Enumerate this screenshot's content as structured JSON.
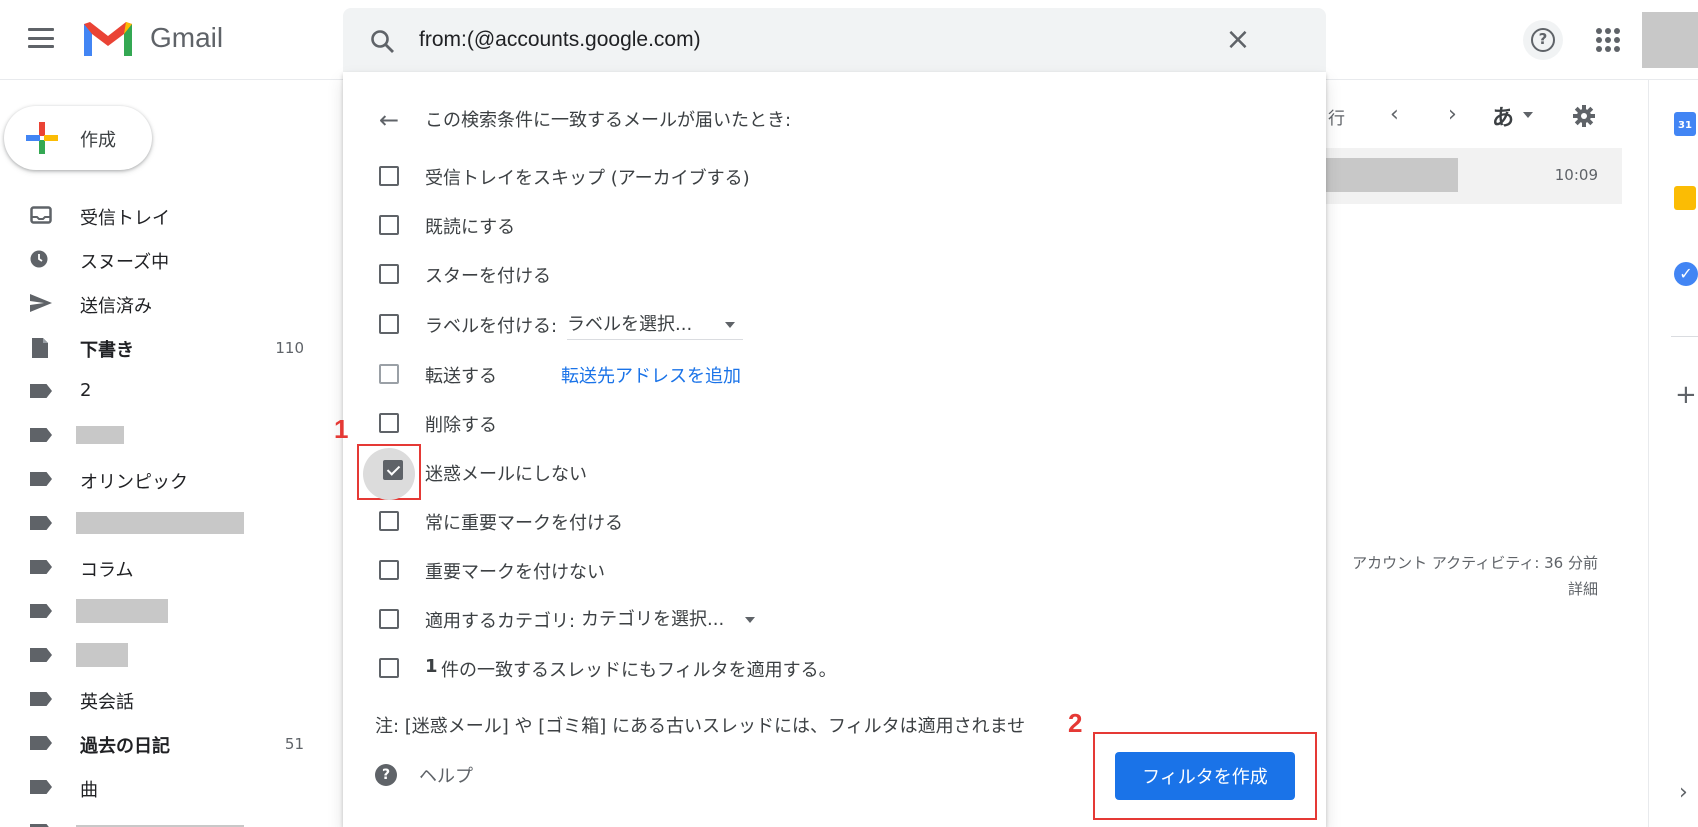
{
  "header": {
    "brand": "Gmail",
    "search_value": "from:(@accounts.google.com)",
    "clear_glyph": "×",
    "help_glyph": "?"
  },
  "sidebar": {
    "compose_label": "作成",
    "items": [
      {
        "label": "受信トレイ",
        "icon": "inbox-icon",
        "count": ""
      },
      {
        "label": "スヌーズ中",
        "icon": "clock-icon",
        "count": ""
      },
      {
        "label": "送信済み",
        "icon": "send-icon",
        "count": ""
      },
      {
        "label": "下書き",
        "icon": "draft-icon",
        "count": "110"
      },
      {
        "label": "2",
        "icon": "label-icon",
        "count": ""
      },
      {
        "label": "",
        "icon": "label-icon",
        "count": ""
      },
      {
        "label": "オリンピック",
        "icon": "label-icon",
        "count": ""
      },
      {
        "label": "",
        "icon": "label-icon",
        "count": ""
      },
      {
        "label": "コラム",
        "icon": "label-icon",
        "count": ""
      },
      {
        "label": "",
        "icon": "label-icon",
        "count": ""
      },
      {
        "label": "",
        "icon": "label-icon",
        "count": ""
      },
      {
        "label": "英会話",
        "icon": "label-icon",
        "count": ""
      },
      {
        "label": "過去の日記",
        "icon": "label-icon",
        "count": "51"
      },
      {
        "label": "曲",
        "icon": "label-icon",
        "count": ""
      },
      {
        "label": "",
        "icon": "label-icon",
        "count": ""
      }
    ]
  },
  "list": {
    "toolbar_text": "行",
    "prev": "‹",
    "next": "›",
    "ime_label": "あ",
    "mail_time": "10:09",
    "activity_line1": "アカウント アクティビティ: 36 分前",
    "activity_line2": "詳細"
  },
  "rail": {
    "calendar_day": "31",
    "tasks_glyph": "✓",
    "add": "+",
    "expand": "›"
  },
  "filter": {
    "back": "←",
    "title": "この検索条件に一致するメールが届いたとき:",
    "options": {
      "skip_inbox": "受信トレイをスキップ (アーカイブする)",
      "mark_read": "既読にする",
      "star": "スターを付ける",
      "apply_label": "ラベルを付ける:",
      "label_select": "ラベルを選択...",
      "forward": "転送する",
      "forward_link": "転送先アドレスを追加",
      "delete": "削除する",
      "never_spam": "迷惑メールにしない",
      "mark_important": "常に重要マークを付ける",
      "never_important": "重要マークを付けない",
      "category": "適用するカテゴリ:",
      "category_select": "カテゴリを選択...",
      "apply_count": "1",
      "apply_existing": "件の一致するスレッドにもフィルタを適用する。"
    },
    "note": "注: [迷惑メール] や [ゴミ箱] にある古いスレッドには、フィルタは適用されませ",
    "help": "ヘルプ",
    "create_button": "フィルタを作成"
  },
  "annotations": {
    "step1": "1",
    "step2": "2"
  },
  "colors": {
    "accent": "#1a73e8",
    "highlight": "#e53935"
  }
}
